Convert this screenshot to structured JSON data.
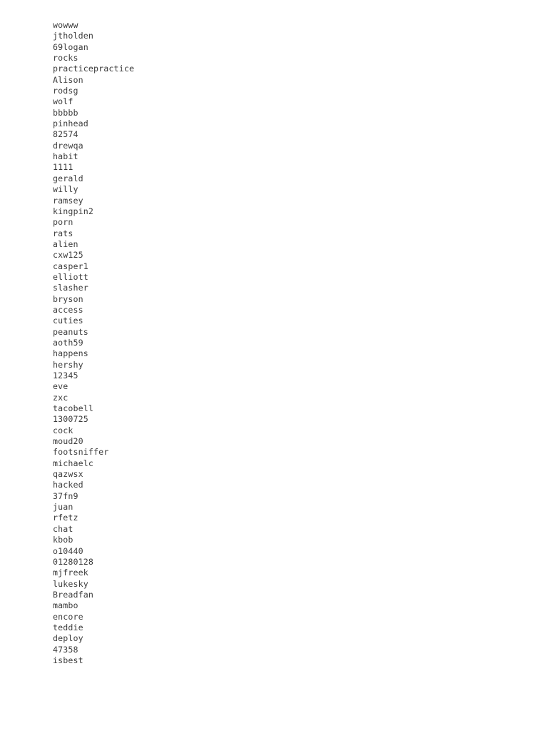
{
  "document": {
    "background_color": "#ffffff",
    "text_color": "#3b3b3b",
    "entry_count": 59,
    "entries": [
      "wowww",
      "jtholden",
      "69logan",
      "rocks",
      "practicepractice",
      "Alison",
      "rodsg",
      "wolf",
      "bbbbb",
      "pinhead",
      "82574",
      "drewqa",
      "habit",
      "1111",
      "gerald",
      "willy",
      "ramsey",
      "kingpin2",
      "porn",
      "rats",
      "alien",
      "cxw125",
      "casper1",
      "elliott",
      "slasher",
      "bryson",
      "access",
      "cuties",
      "peanuts",
      "aoth59",
      "happens",
      "hershy",
      "12345",
      "eve",
      "zxc",
      "tacobell",
      "1300725",
      "cock",
      "moud20",
      "footsniffer",
      "michaelc",
      "qazwsx",
      "hacked",
      "37fn9",
      "juan",
      "rfetz",
      "chat",
      "kbob",
      "o10440",
      "01280128",
      "mjfreek",
      "lukesky",
      "Breadfan",
      "mambo",
      "encore",
      "teddie",
      "deploy",
      "47358",
      "isbest"
    ]
  }
}
